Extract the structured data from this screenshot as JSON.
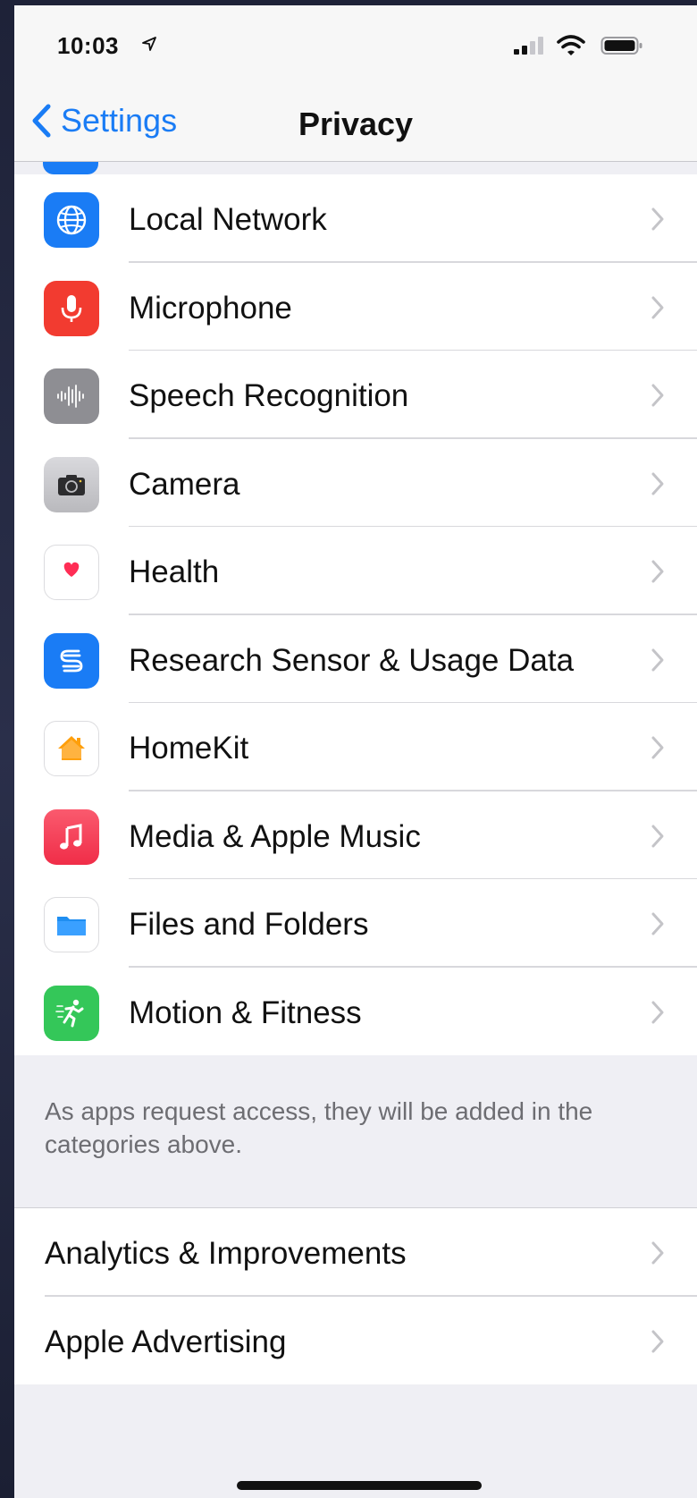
{
  "status_bar": {
    "time": "10:03"
  },
  "nav": {
    "back_label": "Settings",
    "title": "Privacy"
  },
  "privacy_items": [
    {
      "label": "Local Network",
      "icon": "globe-icon",
      "color": "#1a7cf5"
    },
    {
      "label": "Microphone",
      "icon": "microphone-icon",
      "color": "#f23b30"
    },
    {
      "label": "Speech Recognition",
      "icon": "waveform-icon",
      "color": "#8e8e93"
    },
    {
      "label": "Camera",
      "icon": "camera-icon",
      "color": "#3a3a3c"
    },
    {
      "label": "Health",
      "icon": "heart-icon",
      "color": "#ffffff"
    },
    {
      "label": "Research Sensor & Usage Data",
      "icon": "research-icon",
      "color": "#1a7cf5"
    },
    {
      "label": "HomeKit",
      "icon": "home-icon",
      "color": "#ffffff"
    },
    {
      "label": "Media & Apple Music",
      "icon": "music-note-icon",
      "color": "#f43c55"
    },
    {
      "label": "Files and Folders",
      "icon": "folder-icon",
      "color": "#ffffff"
    },
    {
      "label": "Motion & Fitness",
      "icon": "running-figure-icon",
      "color": "#34c759"
    }
  ],
  "footer_note": "As apps request access, they will be added in the categories above.",
  "other_items": [
    {
      "label": "Analytics & Improvements"
    },
    {
      "label": "Apple Advertising"
    }
  ]
}
